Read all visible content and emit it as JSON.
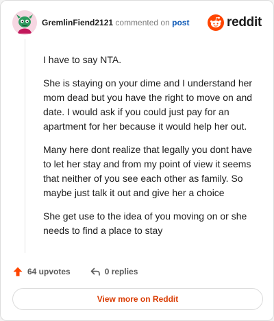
{
  "comment": {
    "username": "GremlinFiend2121",
    "action_text": "commented on",
    "target_link": "post",
    "paragraphs": [
      "I have to say NTA.",
      "She is staying on your dime and I understand her mom dead but you have the right to move on and date. I would ask if you could just pay for an apartment for her because it would help her out.",
      "Many here dont realize that legally you dont have to let her stay and from my point of view it seems that neither of you see each other as family. So maybe just talk it out and give her a choice",
      "She get use to the idea of you moving on or she needs to find a place to stay"
    ]
  },
  "brand": {
    "wordmark": "reddit",
    "color": "#ff4500"
  },
  "actions": {
    "upvotes_label": "64 upvotes",
    "replies_label": "0 replies",
    "upvote_icon": "upvote-arrow-icon",
    "reply_icon": "reply-arrow-icon"
  },
  "cta": {
    "label": "View more on Reddit"
  },
  "colors": {
    "upvote": "#ff4500",
    "link": "#0a57b5",
    "cta_text": "#d93a00"
  }
}
